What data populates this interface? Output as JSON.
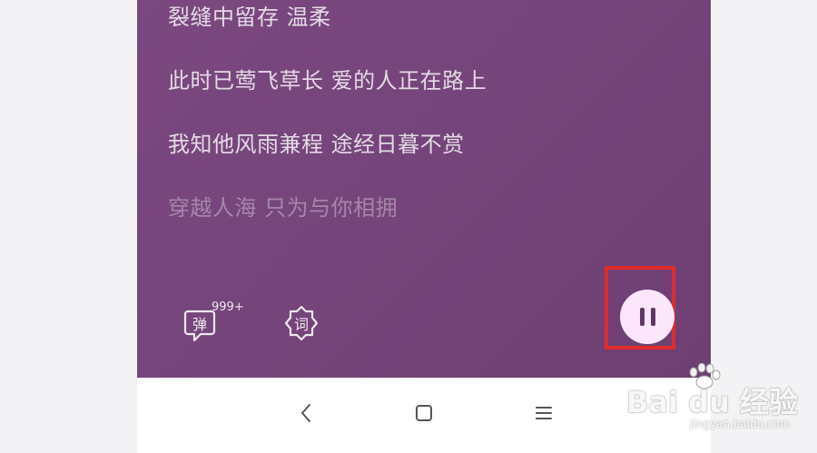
{
  "lyrics": [
    "裂缝中留存 温柔",
    "此时已莺飞草长 爱的人正在路上",
    "我知他风雨兼程 途经日暮不赏",
    "穿越人海 只为与你相拥"
  ],
  "controls": {
    "danmu_label": "弹",
    "danmu_count": "999+",
    "lyric_label": "词",
    "pause_icon": "pause-icon"
  },
  "nav": {
    "back_icon": "back-chevron-icon",
    "home_icon": "home-square-icon",
    "menu_icon": "menu-lines-icon"
  },
  "watermark": {
    "brand": "Bai du 经验",
    "url": "jingyan.baidu.com"
  },
  "colors": {
    "player_bg": "#74447a",
    "highlight_border": "#e02b2b",
    "pause_button_bg": "#fbe6fb",
    "page_bg": "#f3f2f4"
  }
}
